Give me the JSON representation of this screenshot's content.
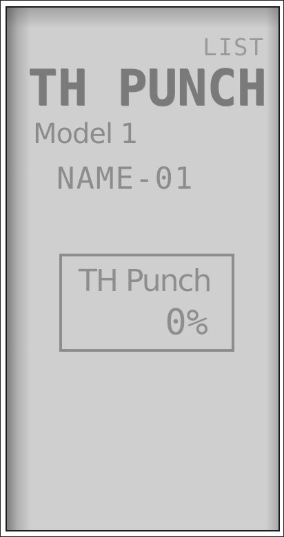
{
  "screen": {
    "menu_label": "LIST",
    "title": "TH PUNCH",
    "model_label": "Model 1",
    "model_name": "NAME-01"
  },
  "punch_setting": {
    "label": "TH Punch",
    "value": "0%"
  }
}
